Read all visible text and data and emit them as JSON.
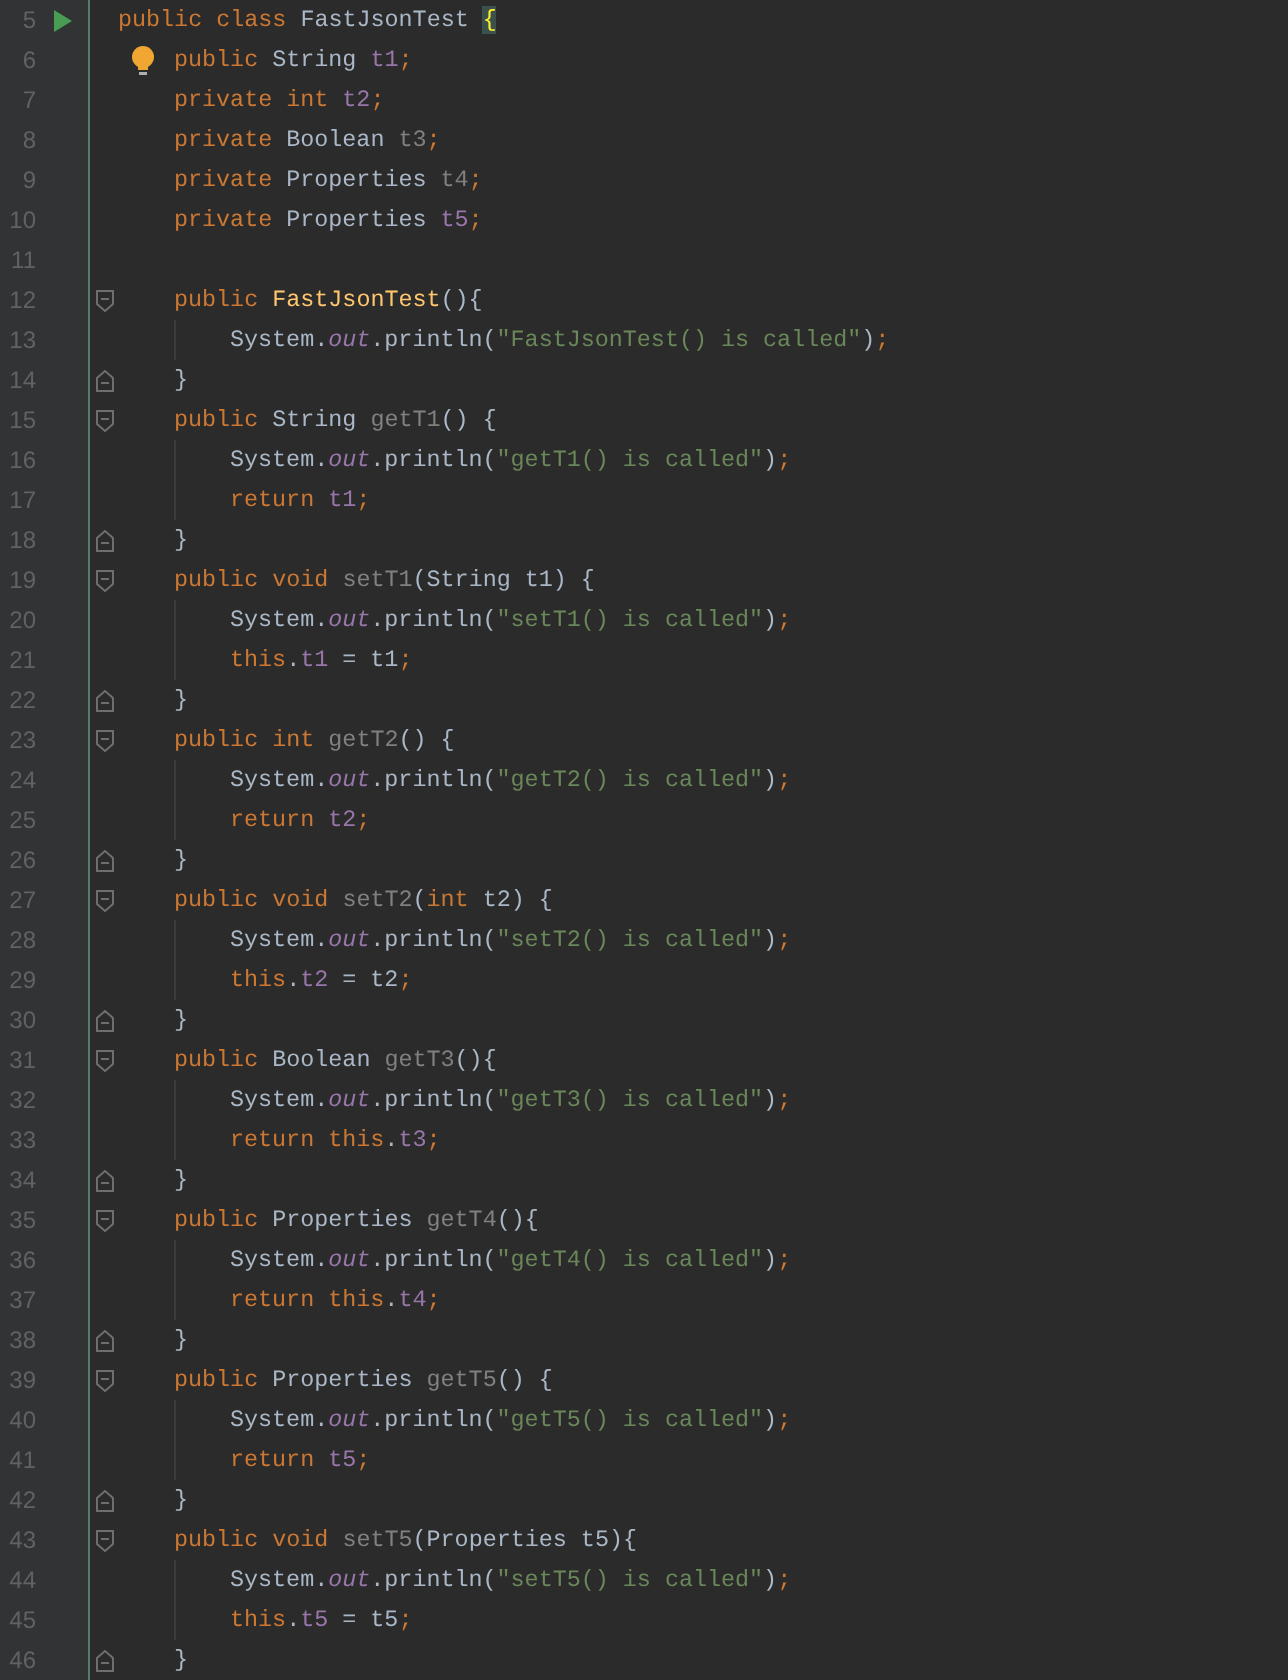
{
  "editor": {
    "lines": [
      {
        "number": "5",
        "run": true,
        "tokens": [
          {
            "text": "public ",
            "kind": "keyword"
          },
          {
            "text": "class ",
            "kind": "keyword"
          },
          {
            "text": "FastJsonTest ",
            "kind": "plain"
          },
          {
            "text": "{",
            "kind": "brace-match"
          }
        ],
        "children": [
          {
            "number": "6",
            "hint": true,
            "tokens": [
              {
                "text": "public ",
                "kind": "keyword"
              },
              {
                "text": "String ",
                "kind": "plain"
              },
              {
                "text": "t1",
                "kind": "field"
              },
              {
                "text": ";",
                "kind": "punct"
              }
            ]
          },
          {
            "number": "7",
            "tokens": [
              {
                "text": "private ",
                "kind": "keyword"
              },
              {
                "text": "int ",
                "kind": "keyword"
              },
              {
                "text": "t2",
                "kind": "field"
              },
              {
                "text": ";",
                "kind": "punct"
              }
            ]
          },
          {
            "number": "8",
            "tokens": [
              {
                "text": "private ",
                "kind": "keyword"
              },
              {
                "text": "Boolean ",
                "kind": "plain"
              },
              {
                "text": "t3",
                "kind": "unused"
              },
              {
                "text": ";",
                "kind": "punct"
              }
            ]
          },
          {
            "number": "9",
            "tokens": [
              {
                "text": "private ",
                "kind": "keyword"
              },
              {
                "text": "Properties ",
                "kind": "plain"
              },
              {
                "text": "t4",
                "kind": "unused"
              },
              {
                "text": ";",
                "kind": "punct"
              }
            ]
          },
          {
            "number": "10",
            "tokens": [
              {
                "text": "private ",
                "kind": "keyword"
              },
              {
                "text": "Properties ",
                "kind": "plain"
              },
              {
                "text": "t5",
                "kind": "field"
              },
              {
                "text": ";",
                "kind": "punct"
              }
            ]
          },
          {
            "number": "11"
          },
          {
            "number": "12",
            "fold_start": true,
            "tokens": [
              {
                "text": "public ",
                "kind": "keyword"
              },
              {
                "text": "FastJsonTest",
                "kind": "decl"
              },
              {
                "text": "(){",
                "kind": "plain"
              }
            ],
            "children": [
              {
                "number": "13",
                "tokens": [
                  {
                    "text": "System.",
                    "kind": "plain"
                  },
                  {
                    "text": "out",
                    "kind": "static"
                  },
                  {
                    "text": ".println(",
                    "kind": "plain"
                  },
                  {
                    "text": "\"FastJsonTest() is called\"",
                    "kind": "string"
                  },
                  {
                    "text": ")",
                    "kind": "plain"
                  },
                  {
                    "text": ";",
                    "kind": "punct"
                  }
                ]
              }
            ]
          },
          {
            "number": "14",
            "fold_end": true,
            "tokens": [
              {
                "text": "}",
                "kind": "plain"
              }
            ]
          },
          {
            "number": "15",
            "fold_start": true,
            "tokens": [
              {
                "text": "public ",
                "kind": "keyword"
              },
              {
                "text": "String ",
                "kind": "plain"
              },
              {
                "text": "getT1",
                "kind": "unused"
              },
              {
                "text": "() {",
                "kind": "plain"
              }
            ],
            "children": [
              {
                "number": "16",
                "tokens": [
                  {
                    "text": "System.",
                    "kind": "plain"
                  },
                  {
                    "text": "out",
                    "kind": "static"
                  },
                  {
                    "text": ".println(",
                    "kind": "plain"
                  },
                  {
                    "text": "\"getT1() is called\"",
                    "kind": "string"
                  },
                  {
                    "text": ")",
                    "kind": "plain"
                  },
                  {
                    "text": ";",
                    "kind": "punct"
                  }
                ]
              },
              {
                "number": "17",
                "tokens": [
                  {
                    "text": "return ",
                    "kind": "keyword"
                  },
                  {
                    "text": "t1",
                    "kind": "field"
                  },
                  {
                    "text": ";",
                    "kind": "punct"
                  }
                ]
              }
            ]
          },
          {
            "number": "18",
            "fold_end": true,
            "tokens": [
              {
                "text": "}",
                "kind": "plain"
              }
            ]
          },
          {
            "number": "19",
            "fold_start": true,
            "tokens": [
              {
                "text": "public ",
                "kind": "keyword"
              },
              {
                "text": "void ",
                "kind": "keyword"
              },
              {
                "text": "setT1",
                "kind": "unused"
              },
              {
                "text": "(String t1) {",
                "kind": "plain"
              }
            ],
            "children": [
              {
                "number": "20",
                "tokens": [
                  {
                    "text": "System.",
                    "kind": "plain"
                  },
                  {
                    "text": "out",
                    "kind": "static"
                  },
                  {
                    "text": ".println(",
                    "kind": "plain"
                  },
                  {
                    "text": "\"setT1() is called\"",
                    "kind": "string"
                  },
                  {
                    "text": ")",
                    "kind": "plain"
                  },
                  {
                    "text": ";",
                    "kind": "punct"
                  }
                ]
              },
              {
                "number": "21",
                "tokens": [
                  {
                    "text": "this",
                    "kind": "keyword"
                  },
                  {
                    "text": ".",
                    "kind": "plain"
                  },
                  {
                    "text": "t1",
                    "kind": "field"
                  },
                  {
                    "text": " = t1",
                    "kind": "plain"
                  },
                  {
                    "text": ";",
                    "kind": "punct"
                  }
                ]
              }
            ]
          },
          {
            "number": "22",
            "fold_end": true,
            "tokens": [
              {
                "text": "}",
                "kind": "plain"
              }
            ]
          },
          {
            "number": "23",
            "fold_start": true,
            "tokens": [
              {
                "text": "public ",
                "kind": "keyword"
              },
              {
                "text": "int ",
                "kind": "keyword"
              },
              {
                "text": "getT2",
                "kind": "unused"
              },
              {
                "text": "() {",
                "kind": "plain"
              }
            ],
            "children": [
              {
                "number": "24",
                "tokens": [
                  {
                    "text": "System.",
                    "kind": "plain"
                  },
                  {
                    "text": "out",
                    "kind": "static"
                  },
                  {
                    "text": ".println(",
                    "kind": "plain"
                  },
                  {
                    "text": "\"getT2() is called\"",
                    "kind": "string"
                  },
                  {
                    "text": ")",
                    "kind": "plain"
                  },
                  {
                    "text": ";",
                    "kind": "punct"
                  }
                ]
              },
              {
                "number": "25",
                "tokens": [
                  {
                    "text": "return ",
                    "kind": "keyword"
                  },
                  {
                    "text": "t2",
                    "kind": "field"
                  },
                  {
                    "text": ";",
                    "kind": "punct"
                  }
                ]
              }
            ]
          },
          {
            "number": "26",
            "fold_end": true,
            "tokens": [
              {
                "text": "}",
                "kind": "plain"
              }
            ]
          },
          {
            "number": "27",
            "fold_start": true,
            "tokens": [
              {
                "text": "public ",
                "kind": "keyword"
              },
              {
                "text": "void ",
                "kind": "keyword"
              },
              {
                "text": "setT2",
                "kind": "unused"
              },
              {
                "text": "(",
                "kind": "plain"
              },
              {
                "text": "int ",
                "kind": "keyword"
              },
              {
                "text": "t2) {",
                "kind": "plain"
              }
            ],
            "children": [
              {
                "number": "28",
                "tokens": [
                  {
                    "text": "System.",
                    "kind": "plain"
                  },
                  {
                    "text": "out",
                    "kind": "static"
                  },
                  {
                    "text": ".println(",
                    "kind": "plain"
                  },
                  {
                    "text": "\"setT2() is called\"",
                    "kind": "string"
                  },
                  {
                    "text": ")",
                    "kind": "plain"
                  },
                  {
                    "text": ";",
                    "kind": "punct"
                  }
                ]
              },
              {
                "number": "29",
                "tokens": [
                  {
                    "text": "this",
                    "kind": "keyword"
                  },
                  {
                    "text": ".",
                    "kind": "plain"
                  },
                  {
                    "text": "t2",
                    "kind": "field"
                  },
                  {
                    "text": " = t2",
                    "kind": "plain"
                  },
                  {
                    "text": ";",
                    "kind": "punct"
                  }
                ]
              }
            ]
          },
          {
            "number": "30",
            "fold_end": true,
            "tokens": [
              {
                "text": "}",
                "kind": "plain"
              }
            ]
          },
          {
            "number": "31",
            "fold_start": true,
            "tokens": [
              {
                "text": "public ",
                "kind": "keyword"
              },
              {
                "text": "Boolean ",
                "kind": "plain"
              },
              {
                "text": "getT3",
                "kind": "unused"
              },
              {
                "text": "(){",
                "kind": "plain"
              }
            ],
            "children": [
              {
                "number": "32",
                "tokens": [
                  {
                    "text": "System.",
                    "kind": "plain"
                  },
                  {
                    "text": "out",
                    "kind": "static"
                  },
                  {
                    "text": ".println(",
                    "kind": "plain"
                  },
                  {
                    "text": "\"getT3() is called\"",
                    "kind": "string"
                  },
                  {
                    "text": ")",
                    "kind": "plain"
                  },
                  {
                    "text": ";",
                    "kind": "punct"
                  }
                ]
              },
              {
                "number": "33",
                "tokens": [
                  {
                    "text": "return ",
                    "kind": "keyword"
                  },
                  {
                    "text": "this",
                    "kind": "keyword"
                  },
                  {
                    "text": ".",
                    "kind": "plain"
                  },
                  {
                    "text": "t3",
                    "kind": "field"
                  },
                  {
                    "text": ";",
                    "kind": "punct"
                  }
                ]
              }
            ]
          },
          {
            "number": "34",
            "fold_end": true,
            "tokens": [
              {
                "text": "}",
                "kind": "plain"
              }
            ]
          },
          {
            "number": "35",
            "fold_start": true,
            "tokens": [
              {
                "text": "public ",
                "kind": "keyword"
              },
              {
                "text": "Properties ",
                "kind": "plain"
              },
              {
                "text": "getT4",
                "kind": "unused"
              },
              {
                "text": "(){",
                "kind": "plain"
              }
            ],
            "children": [
              {
                "number": "36",
                "tokens": [
                  {
                    "text": "System.",
                    "kind": "plain"
                  },
                  {
                    "text": "out",
                    "kind": "static"
                  },
                  {
                    "text": ".println(",
                    "kind": "plain"
                  },
                  {
                    "text": "\"getT4() is called\"",
                    "kind": "string"
                  },
                  {
                    "text": ")",
                    "kind": "plain"
                  },
                  {
                    "text": ";",
                    "kind": "punct"
                  }
                ]
              },
              {
                "number": "37",
                "tokens": [
                  {
                    "text": "return ",
                    "kind": "keyword"
                  },
                  {
                    "text": "this",
                    "kind": "keyword"
                  },
                  {
                    "text": ".",
                    "kind": "plain"
                  },
                  {
                    "text": "t4",
                    "kind": "field"
                  },
                  {
                    "text": ";",
                    "kind": "punct"
                  }
                ]
              }
            ]
          },
          {
            "number": "38",
            "fold_end": true,
            "tokens": [
              {
                "text": "}",
                "kind": "plain"
              }
            ]
          },
          {
            "number": "39",
            "fold_start": true,
            "tokens": [
              {
                "text": "public ",
                "kind": "keyword"
              },
              {
                "text": "Properties ",
                "kind": "plain"
              },
              {
                "text": "getT5",
                "kind": "unused"
              },
              {
                "text": "() {",
                "kind": "plain"
              }
            ],
            "children": [
              {
                "number": "40",
                "tokens": [
                  {
                    "text": "System.",
                    "kind": "plain"
                  },
                  {
                    "text": "out",
                    "kind": "static"
                  },
                  {
                    "text": ".println(",
                    "kind": "plain"
                  },
                  {
                    "text": "\"getT5() is called\"",
                    "kind": "string"
                  },
                  {
                    "text": ")",
                    "kind": "plain"
                  },
                  {
                    "text": ";",
                    "kind": "punct"
                  }
                ]
              },
              {
                "number": "41",
                "tokens": [
                  {
                    "text": "return ",
                    "kind": "keyword"
                  },
                  {
                    "text": "t5",
                    "kind": "field"
                  },
                  {
                    "text": ";",
                    "kind": "punct"
                  }
                ]
              }
            ]
          },
          {
            "number": "42",
            "fold_end": true,
            "tokens": [
              {
                "text": "}",
                "kind": "plain"
              }
            ]
          },
          {
            "number": "43",
            "fold_start": true,
            "tokens": [
              {
                "text": "public ",
                "kind": "keyword"
              },
              {
                "text": "void ",
                "kind": "keyword"
              },
              {
                "text": "setT5",
                "kind": "unused"
              },
              {
                "text": "(Properties t5){",
                "kind": "plain"
              }
            ],
            "children": [
              {
                "number": "44",
                "tokens": [
                  {
                    "text": "System.",
                    "kind": "plain"
                  },
                  {
                    "text": "out",
                    "kind": "static"
                  },
                  {
                    "text": ".println(",
                    "kind": "plain"
                  },
                  {
                    "text": "\"setT5() is called\"",
                    "kind": "string"
                  },
                  {
                    "text": ")",
                    "kind": "plain"
                  },
                  {
                    "text": ";",
                    "kind": "punct"
                  }
                ]
              },
              {
                "number": "45",
                "tokens": [
                  {
                    "text": "this",
                    "kind": "keyword"
                  },
                  {
                    "text": ".",
                    "kind": "plain"
                  },
                  {
                    "text": "t5",
                    "kind": "field"
                  },
                  {
                    "text": " = t5",
                    "kind": "plain"
                  },
                  {
                    "text": ";",
                    "kind": "punct"
                  }
                ]
              }
            ]
          },
          {
            "number": "46",
            "fold_end": true,
            "tokens": [
              {
                "text": "}",
                "kind": "plain"
              }
            ]
          }
        ]
      }
    ]
  }
}
